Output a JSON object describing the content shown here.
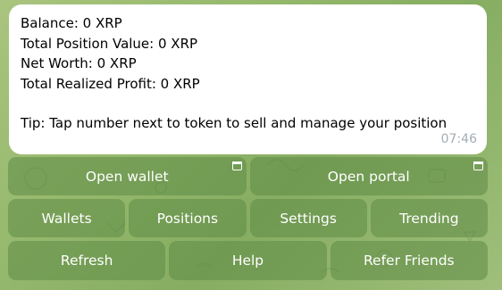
{
  "message": {
    "lines": [
      "Balance: 0 XRP",
      "Total Position Value: 0 XRP",
      "Net Worth: 0 XRP",
      "Total Realized Profit: 0 XRP",
      "Tip: Tap number next to token to sell and manage your position"
    ],
    "time": "07:46"
  },
  "keyboard": {
    "open_wallet": "Open wallet",
    "open_portal": "Open portal",
    "wallets": "Wallets",
    "positions": "Positions",
    "settings": "Settings",
    "trending": "Trending",
    "refresh": "Refresh",
    "help": "Help",
    "refer_friends": "Refer Friends"
  },
  "colors": {
    "background": "#94b86c",
    "button": "#6e9a55",
    "bubble": "#ffffff",
    "time_text": "#a2acb4"
  },
  "icons": {
    "webapp": "web-app-window-icon"
  }
}
